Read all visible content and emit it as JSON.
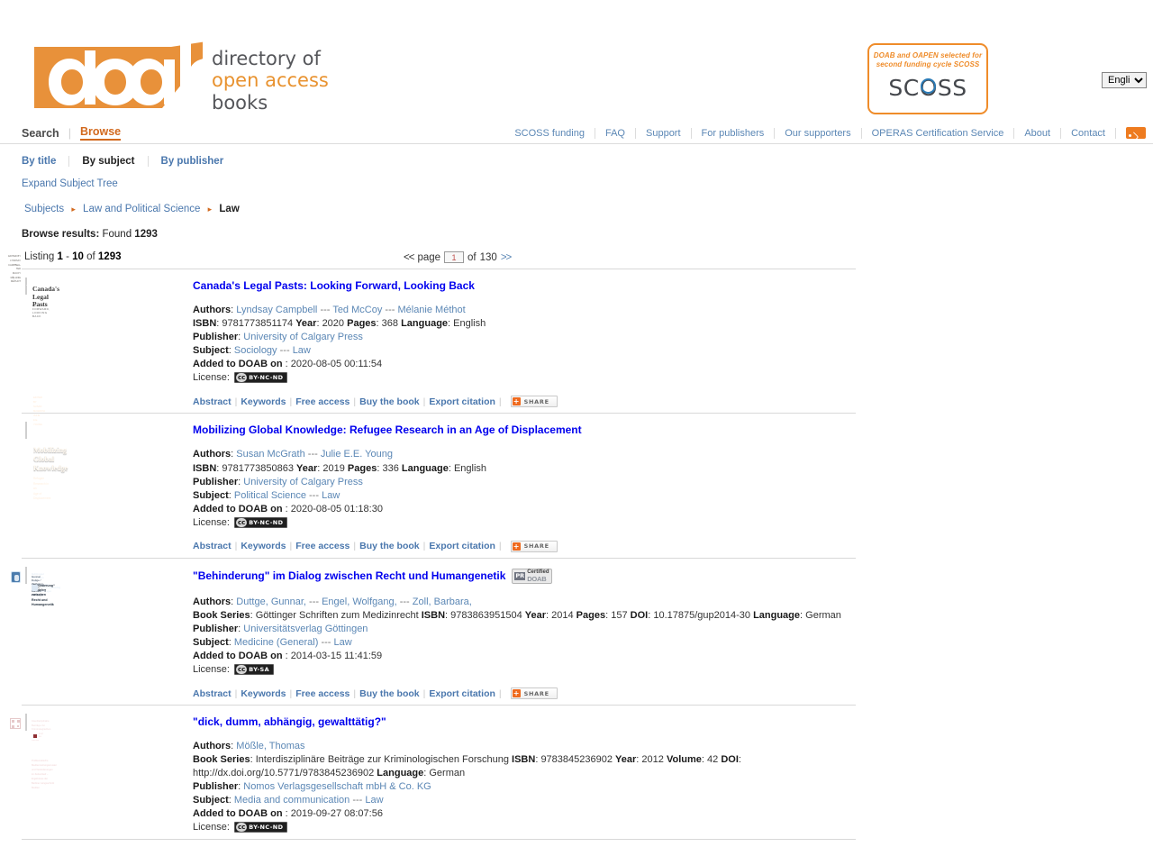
{
  "header": {
    "logo": {
      "wordmark": "doab",
      "line1": "directory of",
      "line2": "open access",
      "line3": "books"
    },
    "scoss_badge": {
      "tagline_line1": "DOAB and OAPEN selected for",
      "tagline_line2": "second funding cycle SCOSS",
      "mark_pre": "SC",
      "mark_o": "O",
      "mark_post": "SS"
    },
    "language_selected": "English",
    "language_options": [
      "English"
    ]
  },
  "topnav": {
    "left": [
      {
        "label": "Search",
        "active": false
      },
      {
        "label": "Browse",
        "active": true
      }
    ],
    "right": [
      "SCOSS funding",
      "FAQ",
      "Support",
      "For publishers",
      "Our supporters",
      "OPERAS Certification Service",
      "About",
      "Contact"
    ],
    "rss_icon": "rss-icon"
  },
  "subnav": {
    "items": [
      {
        "label": "By title",
        "active": false
      },
      {
        "label": "By subject",
        "active": true
      },
      {
        "label": "By publisher",
        "active": false
      }
    ],
    "expand_tree": "Expand Subject Tree"
  },
  "breadcrumb": {
    "items": [
      "Subjects",
      "Law and Political Science"
    ],
    "current": "Law",
    "arrow": "▸"
  },
  "results_summary": {
    "label": "Browse results:",
    "found_label": "Found",
    "found_count": "1293"
  },
  "listing": {
    "prefix": "Listing",
    "from": "1",
    "dash": "-",
    "to": "10",
    "of": "of",
    "total": "1293",
    "pager": {
      "prev": "<<",
      "page_label": "page",
      "page_value": "1",
      "of_label": "of",
      "total_pages": "130",
      "next": ">>"
    }
  },
  "labels": {
    "authors": "Authors",
    "isbn": "ISBN",
    "year": "Year",
    "pages": "Pages",
    "language": "Language",
    "publisher": "Publisher",
    "subject": "Subject",
    "added": "Added to DOAB on",
    "license": "License:",
    "book_series": "Book Series",
    "doi": "DOI",
    "volume": "Volume",
    "separator": "---",
    "colon": ":"
  },
  "actions": {
    "abstract": "Abstract",
    "keywords": "Keywords",
    "free_access": "Free access",
    "buy_the_book": "Buy the book",
    "export_citation": "Export citation",
    "share": "SHARE",
    "share_plus": "+"
  },
  "peer_badge": {
    "pr": "PR",
    "certified": "Certified",
    "doab": "DOAB"
  },
  "colors": {
    "brand_orange": "#ef8c2a",
    "link_blue": "#5b87b5",
    "nav_active": "#d2691e"
  },
  "books": [
    {
      "title": "Canada's Legal Pasts: Looking Forward, Looking Back",
      "peer_reviewed": false,
      "authors": [
        "Lyndsay Campbell",
        "Ted McCoy",
        "Mélanie Méthot"
      ],
      "isbn": "9781773851174",
      "year": "2020",
      "pages": "368",
      "language": "English",
      "publisher": "University of Calgary Press",
      "subjects": [
        "Sociology",
        "Law"
      ],
      "added": "2020-08-05 00:11:54",
      "license": "BY-NC-ND",
      "cover": {
        "style": "cv1",
        "title": "Canada's\nLegal Pasts",
        "subtitle": "LOOKING FORWARD, LOOKING BACK",
        "authors": "EDITED BY\nLYNDSAY CAMPBELL\nTED McCOY\nMÉLANIE MÉTHOT"
      }
    },
    {
      "title": "Mobilizing Global Knowledge: Refugee Research in an Age of Displacement",
      "peer_reviewed": false,
      "authors": [
        "Susan McGrath",
        "Julie E.E. Young"
      ],
      "isbn": "9781773850863",
      "year": "2019",
      "pages": "336",
      "language": "English",
      "publisher": "University of Calgary Press",
      "subjects": [
        "Political Science",
        "Law"
      ],
      "added": "2020-08-05 01:18:30",
      "license": "BY-NC-ND",
      "cover": {
        "style": "cv2",
        "title": "Mobilizing\nGlobal\nKnowledge",
        "subtitle": "Refugee Research in an\nAge of Displacement",
        "authors": "EDITED BY\nSUSAN McGRATH\nJULIE E.E. YOUNG"
      }
    },
    {
      "title": "\"Behinderung\" im Dialog zwischen Recht und Humangenetik",
      "peer_reviewed": true,
      "authors": [
        "Duttge, Gunnar,",
        "Engel, Wolfgang,",
        "Zoll, Barbara,"
      ],
      "book_series": "Göttinger Schriften zum Medizinrecht",
      "isbn": "9783863951504",
      "year": "2014",
      "pages": "157",
      "doi": "10.17875/gup2014-30",
      "language": "German",
      "publisher": "Universitätsverlag Göttingen",
      "subjects": [
        "Medicine (General)",
        "Law"
      ],
      "added": "2014-03-15 11:41:59",
      "license": "BY-SA",
      "cover": {
        "style": "cv3",
        "series": "Göttinger Schriften zum Medizinrecht",
        "volume": "Band 17",
        "authors": "Gunnar Duttge / Wolfgang Engel / Barbara Zoll (Hg.)",
        "title": "„Behinderung“ im Dialog zwischen\nRecht und Humangenetik",
        "publisher": "Universitätsverlag Göttingen"
      }
    },
    {
      "title": "\"dick, dumm, abhängig, gewalttätig?\"",
      "peer_reviewed": false,
      "authors": [
        "Mößle, Thomas"
      ],
      "book_series": "Interdisziplinäre Beiträge zur Kriminologischen Forschung",
      "isbn": "9783845236902",
      "year": "2012",
      "volume": "42",
      "doi": "http://dx.doi.org/10.5771/9783845236902",
      "language": "German",
      "publisher": "Nomos Verlagsgesellschaft mbH & Co. KG",
      "subjects": [
        "Media and communication",
        "Law"
      ],
      "added": "2019-09-27 08:07:56",
      "license": "BY-NC-ND",
      "cover": {
        "style": "cv4",
        "series": "Interdisziplinäre Beiträge zur\nKriminologischen Forschung",
        "author": "Thomas Mößle",
        "title": "„dick, dumm, abhängig,\ngewalttätig?“",
        "subtitle": "Problematische Mediennutzungsmuster und Veränderungen\nim Zeitverlauf – Ergebnisse der Berliner Längsschnitt Medien",
        "publisher": "Nomos"
      }
    }
  ]
}
